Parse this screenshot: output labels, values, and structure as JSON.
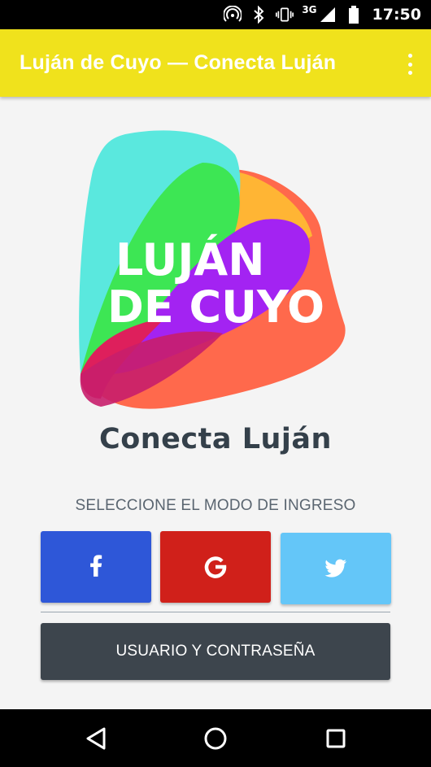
{
  "status_bar": {
    "network": "3G",
    "time": "17:50",
    "icons": [
      "hotspot-icon",
      "bluetooth-icon",
      "vibrate-icon",
      "signal-icon",
      "battery-icon"
    ]
  },
  "app_bar": {
    "title": "Luján de Cuyo — Conecta Luján",
    "menu_icon": "more-vert-icon",
    "color": "#f0e21c"
  },
  "logo": {
    "line1": "LUJÁN",
    "line2": "DE CUYO"
  },
  "brand_name": "Conecta Luján",
  "login": {
    "prompt": "SELECCIONE EL MODO DE INGRESO",
    "facebook": {
      "icon": "facebook-icon",
      "color": "#2e57d8"
    },
    "google": {
      "icon": "google-icon",
      "color": "#d0201a"
    },
    "twitter": {
      "icon": "twitter-icon",
      "color": "#64c6f8"
    },
    "user_password_label": "USUARIO Y CONTRASEÑA"
  },
  "nav_bar": {
    "buttons": [
      "back-icon",
      "home-icon",
      "recents-icon"
    ]
  }
}
